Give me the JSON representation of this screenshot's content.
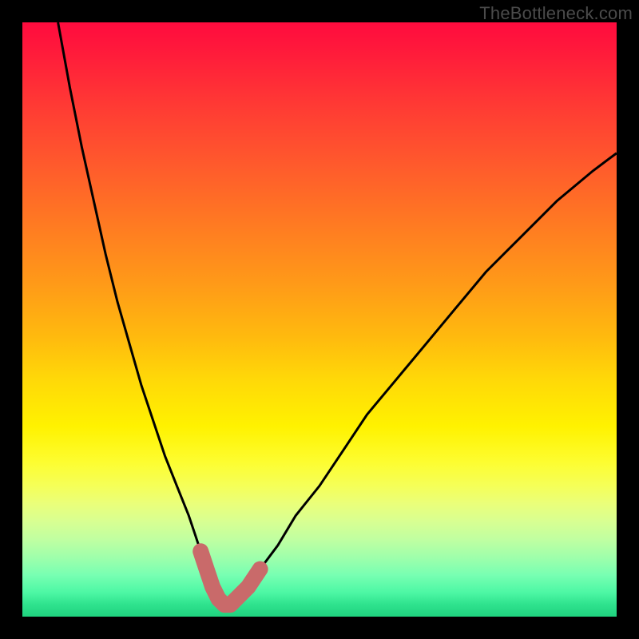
{
  "watermark": "TheBottleneck.com",
  "colors": {
    "frame": "#000000",
    "curve": "#000000",
    "marker": "#c96a6a"
  },
  "chart_data": {
    "type": "line",
    "title": "",
    "xlabel": "",
    "ylabel": "",
    "xlim": [
      0,
      100
    ],
    "ylim": [
      0,
      100
    ],
    "note": "V-shaped bottleneck curve on a red-to-green vertical gradient. Minimum (green zone) near x≈34. Pink markers highlight the near-optimal region around the valley.",
    "series": [
      {
        "name": "left-branch",
        "x": [
          6,
          8,
          10,
          12,
          14,
          16,
          18,
          20,
          22,
          24,
          26,
          28,
          29,
          30,
          31,
          32,
          33,
          34
        ],
        "y": [
          100,
          89,
          79,
          70,
          61,
          53,
          46,
          39,
          33,
          27,
          22,
          17,
          14,
          11,
          8,
          5,
          3,
          2
        ]
      },
      {
        "name": "right-branch",
        "x": [
          34,
          36,
          38,
          40,
          43,
          46,
          50,
          54,
          58,
          63,
          68,
          73,
          78,
          84,
          90,
          96,
          100
        ],
        "y": [
          2,
          3,
          5,
          8,
          12,
          17,
          22,
          28,
          34,
          40,
          46,
          52,
          58,
          64,
          70,
          75,
          78
        ]
      }
    ],
    "markers": {
      "name": "optimal-zone",
      "color": "#c96a6a",
      "points": [
        {
          "x": 30,
          "y": 11
        },
        {
          "x": 31,
          "y": 8
        },
        {
          "x": 32,
          "y": 5
        },
        {
          "x": 33,
          "y": 3
        },
        {
          "x": 34,
          "y": 2
        },
        {
          "x": 35,
          "y": 2
        },
        {
          "x": 36,
          "y": 3
        },
        {
          "x": 37,
          "y": 4
        },
        {
          "x": 38,
          "y": 5
        },
        {
          "x": 40,
          "y": 8
        }
      ]
    }
  }
}
